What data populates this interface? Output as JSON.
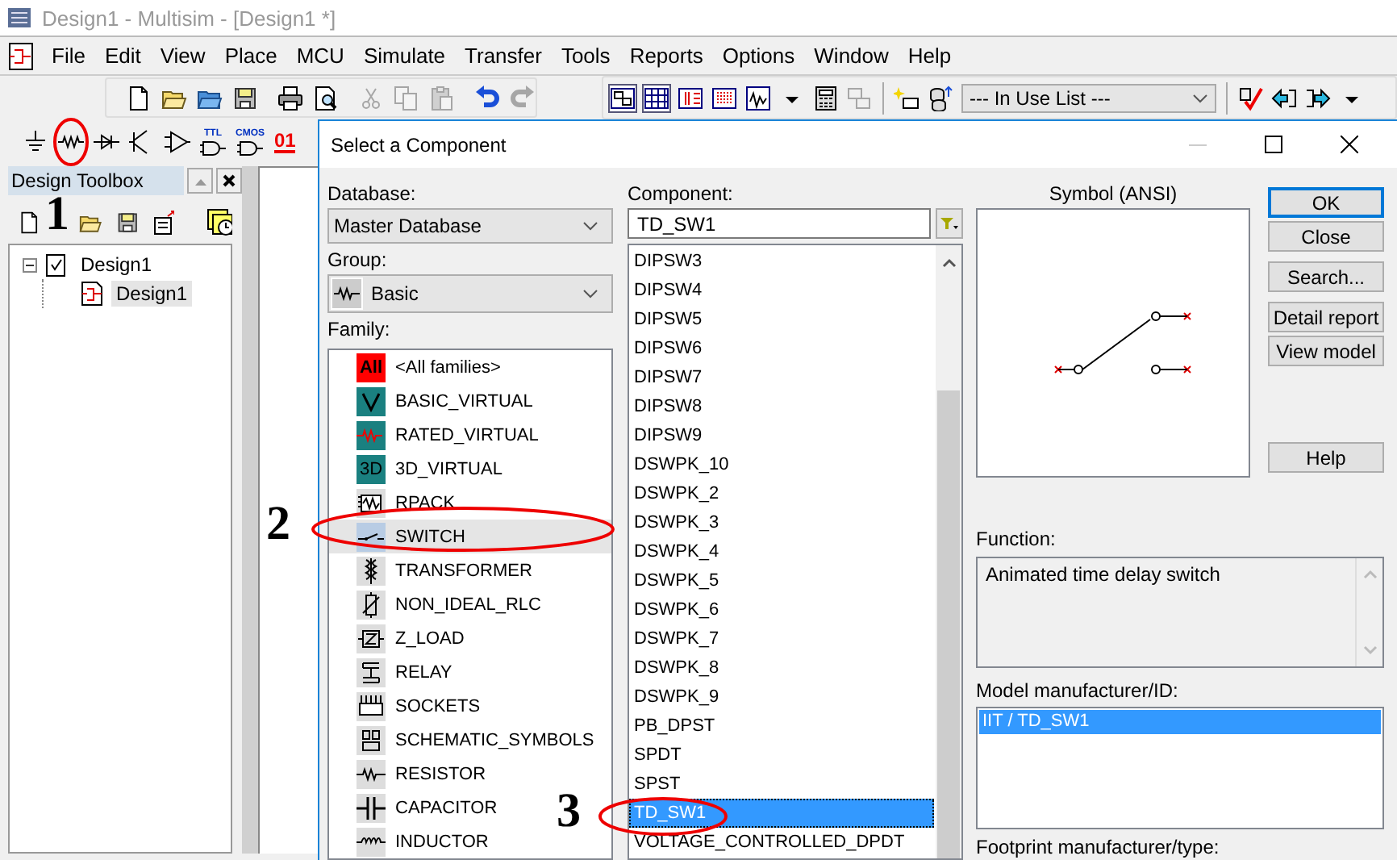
{
  "title_bar": {
    "title": "Design1 - Multisim - [Design1 *]"
  },
  "menu_bar": {
    "items": [
      "File",
      "Edit",
      "View",
      "Place",
      "MCU",
      "Simulate",
      "Transfer",
      "Tools",
      "Reports",
      "Options",
      "Window",
      "Help"
    ]
  },
  "main_toolbar": {
    "bands": [
      {
        "groups": [
          [
            {
              "kind": "new",
              "disabled": false,
              "pressed": false
            },
            {
              "kind": "open",
              "disabled": false,
              "pressed": false
            },
            {
              "kind": "open_blue",
              "disabled": false,
              "pressed": false
            },
            {
              "kind": "save",
              "disabled": false,
              "pressed": false
            }
          ],
          [
            {
              "kind": "print",
              "disabled": false,
              "pressed": false
            },
            {
              "kind": "preview",
              "disabled": false,
              "pressed": false
            }
          ],
          [
            {
              "kind": "cut",
              "disabled": true,
              "pressed": false
            },
            {
              "kind": "copy",
              "disabled": true,
              "pressed": false
            },
            {
              "kind": "paste",
              "disabled": true,
              "pressed": false
            }
          ],
          [
            {
              "kind": "undo",
              "disabled": false,
              "pressed": false
            },
            {
              "kind": "redo",
              "disabled": true,
              "pressed": false
            }
          ]
        ]
      },
      {
        "groups": [
          [
            {
              "kind": "toolbox_view",
              "disabled": false,
              "pressed": true
            },
            {
              "kind": "spreadsheet_view",
              "disabled": false,
              "pressed": true
            },
            {
              "kind": "columns_view",
              "disabled": false,
              "pressed": false
            },
            {
              "kind": "table_view",
              "disabled": false,
              "pressed": false
            },
            {
              "kind": "grapher",
              "disabled": false,
              "pressed": false
            },
            {
              "kind": "caret",
              "disabled": false,
              "pressed": false
            },
            {
              "kind": "calculator",
              "disabled": false,
              "pressed": false
            },
            {
              "kind": "transfer",
              "disabled": true,
              "pressed": false
            }
          ],
          [
            {
              "kind": "new_part",
              "disabled": false,
              "pressed": false
            },
            {
              "kind": "database",
              "disabled": false,
              "pressed": false
            },
            {
              "kind": "combo",
              "value": "--- In Use List ---"
            }
          ],
          [
            {
              "kind": "erc",
              "disabled": false,
              "pressed": false
            },
            {
              "kind": "back",
              "disabled": false,
              "pressed": false
            },
            {
              "kind": "forward",
              "disabled": false,
              "pressed": false
            },
            {
              "kind": "caret",
              "disabled": false,
              "pressed": false
            }
          ]
        ]
      }
    ]
  },
  "component_toolbar": {
    "items": [
      {
        "kind": "source"
      },
      {
        "kind": "basic"
      },
      {
        "kind": "diode"
      },
      {
        "kind": "transistor"
      },
      {
        "kind": "analog"
      },
      {
        "kind": "ttl",
        "text": "TTL"
      },
      {
        "kind": "cmos",
        "text": "CMOS"
      },
      {
        "kind": "mcu",
        "text": "01"
      }
    ]
  },
  "design_toolbox": {
    "title": "Design Toolbox",
    "tree": [
      {
        "label": "Design1",
        "kind": "design",
        "expanded": true,
        "selected": false,
        "children": [
          {
            "label": "Design1",
            "kind": "sheet",
            "selected": true
          }
        ]
      }
    ]
  },
  "dialog": {
    "title": "Select a Component",
    "database": {
      "label": "Database:",
      "value": "Master Database"
    },
    "group": {
      "label": "Group:",
      "value": "Basic"
    },
    "family": {
      "label": "Family:",
      "items": [
        {
          "label": "<All families>",
          "kind": "all",
          "icon_text": "All",
          "selected": false
        },
        {
          "label": "BASIC_VIRTUAL",
          "kind": "basic_virtual",
          "selected": false
        },
        {
          "label": "RATED_VIRTUAL",
          "kind": "rated_virtual",
          "selected": false
        },
        {
          "label": "3D_VIRTUAL",
          "kind": "virtual3d",
          "icon_text": "3D",
          "selected": false
        },
        {
          "label": "RPACK",
          "kind": "rpack",
          "selected": false
        },
        {
          "label": "SWITCH",
          "kind": "switch",
          "selected": true
        },
        {
          "label": "TRANSFORMER",
          "kind": "transformer",
          "selected": false
        },
        {
          "label": "NON_IDEAL_RLC",
          "kind": "non_ideal_rlc",
          "selected": false
        },
        {
          "label": "Z_LOAD",
          "kind": "z_load",
          "selected": false
        },
        {
          "label": "RELAY",
          "kind": "relay",
          "selected": false
        },
        {
          "label": "SOCKETS",
          "kind": "sockets",
          "selected": false
        },
        {
          "label": "SCHEMATIC_SYMBOLS",
          "kind": "schematic_symbols",
          "selected": false
        },
        {
          "label": "RESISTOR",
          "kind": "resistor",
          "selected": false
        },
        {
          "label": "CAPACITOR",
          "kind": "capacitor",
          "selected": false
        },
        {
          "label": "INDUCTOR",
          "kind": "inductor",
          "selected": false
        }
      ]
    },
    "component": {
      "label": "Component:",
      "value": "TD_SW1",
      "items": [
        {
          "label": "DIPSW3",
          "selected": false
        },
        {
          "label": "DIPSW4",
          "selected": false
        },
        {
          "label": "DIPSW5",
          "selected": false
        },
        {
          "label": "DIPSW6",
          "selected": false
        },
        {
          "label": "DIPSW7",
          "selected": false
        },
        {
          "label": "DIPSW8",
          "selected": false
        },
        {
          "label": "DIPSW9",
          "selected": false
        },
        {
          "label": "DSWPK_10",
          "selected": false
        },
        {
          "label": "DSWPK_2",
          "selected": false
        },
        {
          "label": "DSWPK_3",
          "selected": false
        },
        {
          "label": "DSWPK_4",
          "selected": false
        },
        {
          "label": "DSWPK_5",
          "selected": false
        },
        {
          "label": "DSWPK_6",
          "selected": false
        },
        {
          "label": "DSWPK_7",
          "selected": false
        },
        {
          "label": "DSWPK_8",
          "selected": false
        },
        {
          "label": "DSWPK_9",
          "selected": false
        },
        {
          "label": "PB_DPST",
          "selected": false
        },
        {
          "label": "SPDT",
          "selected": false
        },
        {
          "label": "SPST",
          "selected": false
        },
        {
          "label": "TD_SW1",
          "selected": true
        },
        {
          "label": "VOLTAGE_CONTROLLED_DPDT",
          "selected": false
        }
      ]
    },
    "symbol": {
      "label": "Symbol (ANSI)"
    },
    "buttons": [
      [
        {
          "label": "OK",
          "default": true
        },
        {
          "label": "Close",
          "default": false
        }
      ],
      [
        {
          "label": "Search...",
          "default": false
        }
      ],
      [
        {
          "label": "Detail report",
          "default": false
        },
        {
          "label": "View model",
          "default": false
        }
      ],
      [
        {
          "label": "Help",
          "default": false
        }
      ]
    ],
    "function": {
      "label": "Function:",
      "text": "Animated time delay switch"
    },
    "model": {
      "label": "Model manufacturer/ID:",
      "items": [
        {
          "label": "IIT / TD_SW1",
          "selected": true
        }
      ]
    },
    "footprint": {
      "label": "Footprint manufacturer/type:"
    }
  },
  "annotations": [
    {
      "label": "1"
    },
    {
      "label": "2"
    },
    {
      "label": "3"
    }
  ]
}
